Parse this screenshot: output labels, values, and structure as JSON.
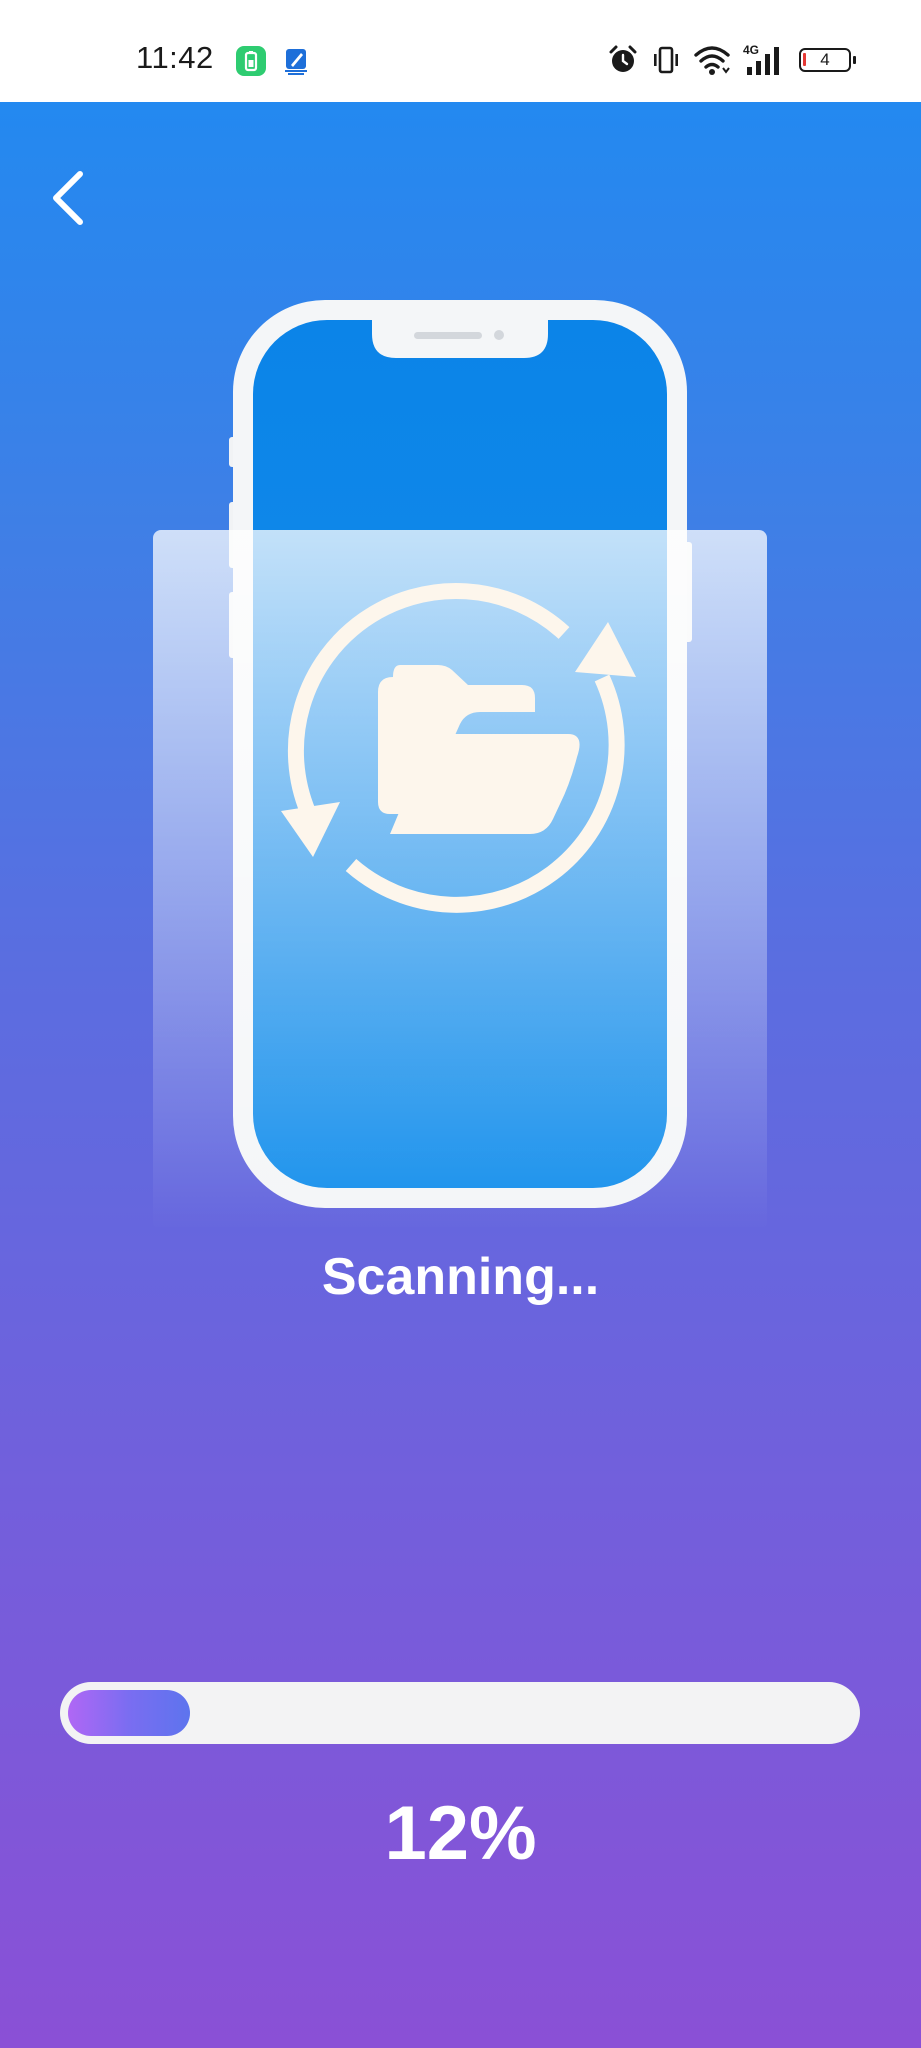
{
  "status_bar": {
    "time": "11:42",
    "battery_level": "4",
    "network_label": "4G",
    "icons": [
      "battery-saver-app-icon",
      "app-notification-icon",
      "alarm-icon",
      "vibrate-icon",
      "wifi-icon",
      "signal-4g-icon",
      "battery-icon"
    ],
    "colors": {
      "battery_saver_green": "#2ecc71",
      "notification_blue": "#1e6fd9",
      "battery_low_red": "#e53935"
    }
  },
  "navigation": {
    "back_icon": "chevron-left-icon"
  },
  "illustration": {
    "subject": "phone-folder-sync-icon"
  },
  "scan": {
    "status_text": "Scanning...",
    "progress_fraction": 0.12,
    "progress_text": "12%"
  },
  "colors": {
    "background_top": "#2389f0",
    "background_bottom": "#8a50d6",
    "progress_track": "#f3f3f4",
    "progress_fill_start": "#b067f5",
    "progress_fill_end": "#5d74ee",
    "text": "#ffffff"
  }
}
